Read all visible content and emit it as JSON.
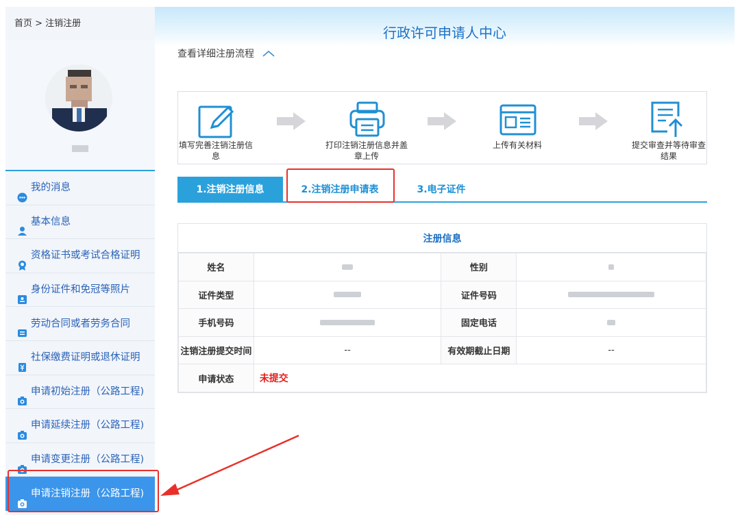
{
  "sidebar": {
    "breadcrumb": "首页 > 注销注册",
    "menu": [
      {
        "label": "我的消息"
      },
      {
        "label": "基本信息"
      },
      {
        "label": "资格证书或考试合格证明"
      },
      {
        "label": "身份证件和免冠等照片"
      },
      {
        "label": "劳动合同或者劳务合同"
      },
      {
        "label": "社保缴费证明或退休证明"
      },
      {
        "label": "申请初始注册（公路工程)"
      },
      {
        "label": "申请延续注册（公路工程)"
      },
      {
        "label": "申请变更注册（公路工程)"
      },
      {
        "label": "申请注销注册（公路工程)"
      }
    ],
    "active_index": 9
  },
  "header": {
    "title": "行政许可申请人中心"
  },
  "flow": {
    "toggle_label": "查看详细注册流程"
  },
  "steps": [
    {
      "label": "填写完善注销注册信息",
      "icon": "edit-icon"
    },
    {
      "label": "打印注销注册信息并盖章上传",
      "icon": "printer-icon"
    },
    {
      "label": "上传有关材料",
      "icon": "document-card-icon"
    },
    {
      "label": "提交审查并等待审查结果",
      "icon": "submit-upload-icon"
    }
  ],
  "tabs": [
    {
      "label": "1.注销注册信息"
    },
    {
      "label": "2.注销注册申请表"
    },
    {
      "label": "3.电子证件"
    }
  ],
  "info": {
    "title": "注册信息",
    "rows": [
      {
        "l1": "姓名",
        "v1": "",
        "l2": "性别",
        "v2": ""
      },
      {
        "l1": "证件类型",
        "v1": "",
        "l2": "证件号码",
        "v2": ""
      },
      {
        "l1": "手机号码",
        "v1": "",
        "l2": "固定电话",
        "v2": ""
      },
      {
        "l1": "注销注册提交时间",
        "v1": "--",
        "l2": "有效期截止日期",
        "v2": "--"
      }
    ],
    "status_label": "申请状态",
    "status_value": "未提交"
  },
  "colors": {
    "accent": "#2ba1dc",
    "active_menu": "#3b95ea",
    "menu_text": "#2a63b8",
    "status_red": "#e3201b",
    "annotation_red": "#e8302a"
  }
}
